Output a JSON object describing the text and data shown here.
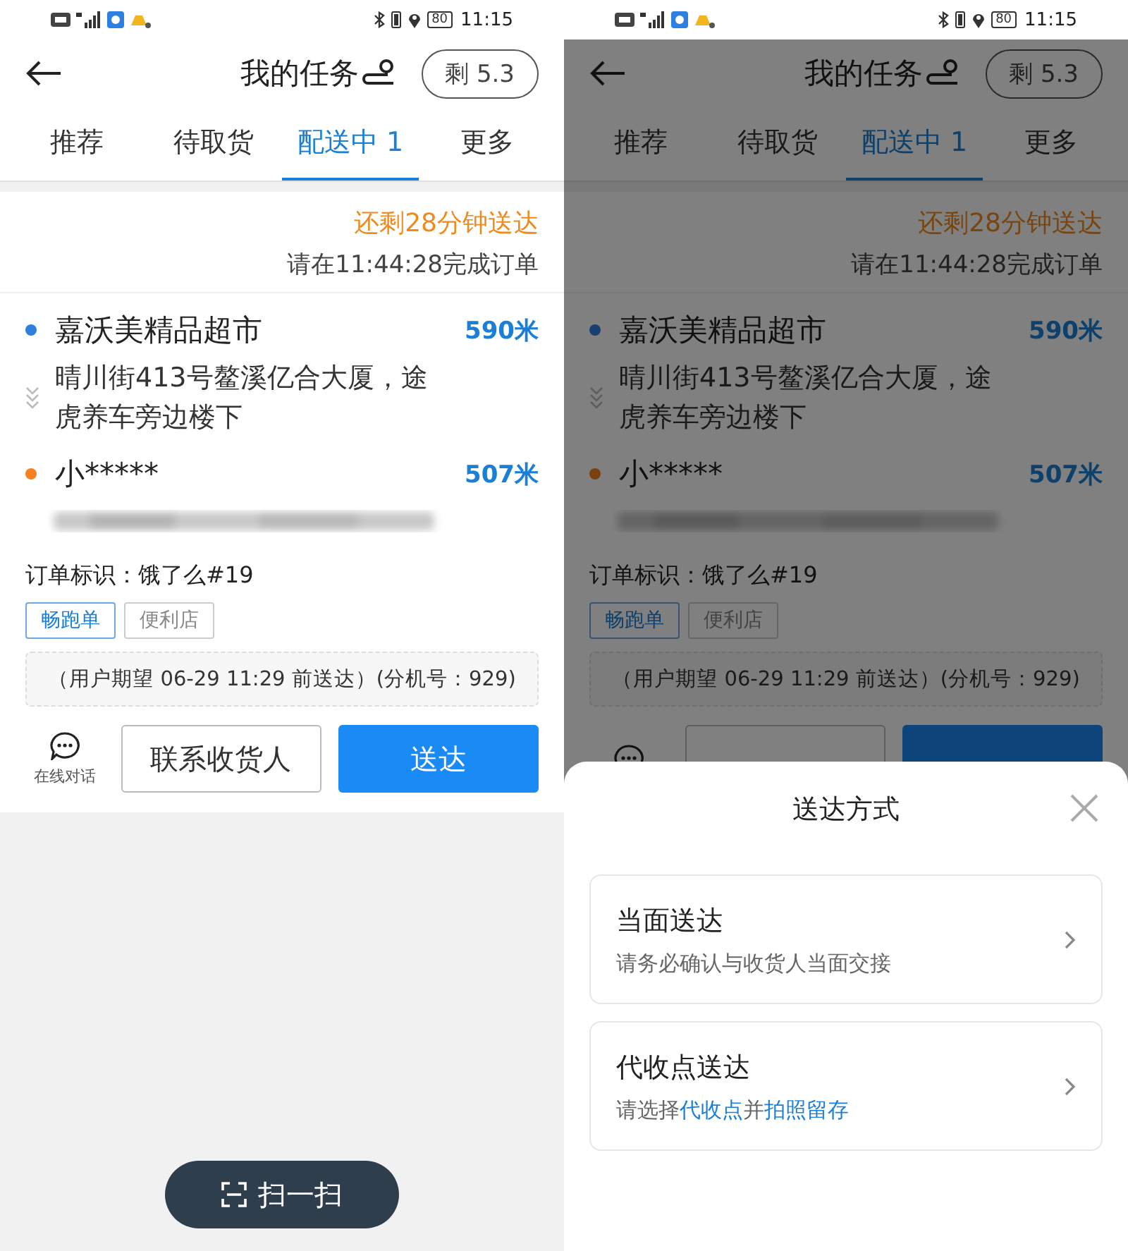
{
  "screens": [
    {
      "dimmed": false,
      "status_bar": {
        "battery": "80",
        "time": "11:15"
      },
      "header": {
        "title": "我的任务",
        "remaining": "剩 5.3"
      },
      "tabs": [
        {
          "label": "推荐",
          "selected": false
        },
        {
          "label": "待取货",
          "selected": false
        },
        {
          "label": "配送中 1",
          "selected": true
        },
        {
          "label": "更多",
          "selected": false
        }
      ],
      "order": {
        "countdown": "还剩28分钟送达",
        "deadline": "请在11:44:28完成订单",
        "stops": [
          {
            "kind": "pickup",
            "color": "#2f7fe0",
            "name": "嘉沃美精品超市",
            "distance": "590米",
            "address": "晴川街413号鳌溪亿合大厦，途虎养车旁边楼下"
          },
          {
            "kind": "dropoff",
            "color": "#f5821f",
            "name": "小*****",
            "distance": "507米"
          }
        ],
        "order_id": "订单标识：饿了么#19",
        "tags": [
          {
            "label": "畅跑单",
            "kind": "primary"
          },
          {
            "label": "便利店",
            "kind": "plain"
          }
        ],
        "note": "（用户期望 06-29 11:29 前送达）(分机号：929)",
        "actions": {
          "chat_label": "在线对话",
          "contact": "联系收货人",
          "deliver": "送达"
        }
      },
      "scan_button": "扫一扫"
    },
    {
      "dimmed": true,
      "status_bar": {
        "battery": "80",
        "time": "11:15"
      },
      "header": {
        "title": "我的任务",
        "remaining": "剩 5.3"
      },
      "tabs": [
        {
          "label": "推荐",
          "selected": false
        },
        {
          "label": "待取货",
          "selected": false
        },
        {
          "label": "配送中 1",
          "selected": true
        },
        {
          "label": "更多",
          "selected": false
        }
      ],
      "order": {
        "countdown": "还剩28分钟送达",
        "deadline": "请在11:44:28完成订单",
        "stops": [
          {
            "kind": "pickup",
            "color": "#173f70",
            "name": "嘉沃美精品超市",
            "distance": "590米",
            "address": "晴川街413号鳌溪亿合大厦，途虎养车旁边楼下"
          },
          {
            "kind": "dropoff",
            "color": "#7a410f",
            "name": "小*****",
            "distance": "507米"
          }
        ],
        "order_id": "订单标识：饿了么#19",
        "tags": [
          {
            "label": "畅跑单",
            "kind": "primary"
          },
          {
            "label": "便利店",
            "kind": "plain"
          }
        ],
        "note": "（用户期望 06-29 11:29 前送达）(分机号：929)"
      },
      "sheet": {
        "title": "送达方式",
        "options": [
          {
            "title": "当面送达",
            "subtitle": [
              {
                "kind": "text",
                "text": "请务必确认与收货人当面交接"
              }
            ]
          },
          {
            "title": "代收点送达",
            "subtitle": [
              {
                "kind": "text",
                "text": "请选择"
              },
              {
                "kind": "link",
                "text": "代收点"
              },
              {
                "kind": "text",
                "text": "并"
              },
              {
                "kind": "link",
                "text": "拍照留存"
              }
            ]
          }
        ]
      }
    }
  ]
}
